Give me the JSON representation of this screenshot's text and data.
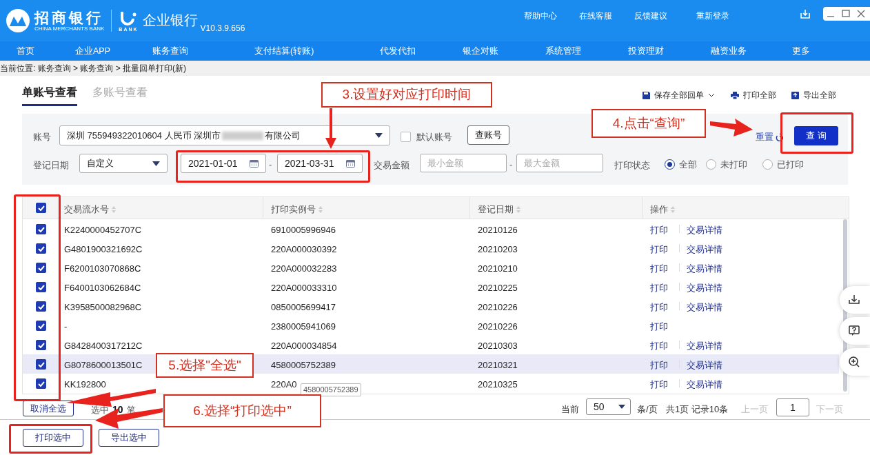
{
  "header": {
    "bank_name": "招商银行",
    "bank_name_en": "CHINA MERCHANTS BANK",
    "sub_brand": "BANK",
    "product": "企业银行",
    "version": "V10.3.9.656",
    "links": [
      "帮助中心",
      "在线客服",
      "反馈建议",
      "重新登录"
    ]
  },
  "nav": [
    "首页",
    "企业APP",
    "账务查询",
    "支付结算(转账)",
    "代发代扣",
    "银企对账",
    "系统管理",
    "投资理财",
    "融资业务",
    "更多"
  ],
  "breadcrumb": "当前位置: 账务查询 > 账务查询 > 批量回单打印(新)",
  "tabs": [
    {
      "label": "单账号查看",
      "selected": true
    },
    {
      "label": "多账号查看",
      "selected": false
    }
  ],
  "toolbar": [
    "保存全部回单",
    "打印全部",
    "导出全部"
  ],
  "filters": {
    "account_label": "账号",
    "account_value_start": "深圳 755949322010604 人民币 深圳市",
    "account_value_end": "有限公司",
    "default_account": {
      "label": "默认账号",
      "checked": false
    },
    "lookup_button": "查账号",
    "date_label": "登记日期",
    "date_mode": "自定义",
    "date_from": "2021-01-01",
    "date_separator": "-",
    "date_to": "2021-03-31",
    "amount_label": "交易金额",
    "amount_min_placeholder": "最小金额",
    "amount_separator": "-",
    "amount_max_placeholder": "最大金额",
    "print_status_label": "打印状态",
    "print_status": [
      {
        "label": "全部",
        "selected": true
      },
      {
        "label": "未打印",
        "selected": false
      },
      {
        "label": "已打印",
        "selected": false
      }
    ],
    "reset": "重置",
    "query": "查 询"
  },
  "table": {
    "all_checked": true,
    "columns": [
      "交易流水号",
      "打印实例号",
      "登记日期",
      "操作"
    ],
    "rows": [
      {
        "serial": "K2240000452707C",
        "instance": "6910005996946",
        "date": "20210126",
        "actions": [
          "打印",
          "交易详情"
        ],
        "checked": true,
        "selected": false
      },
      {
        "serial": "G4801900321692C",
        "instance": "220A000030392",
        "date": "20210203",
        "actions": [
          "打印",
          "交易详情"
        ],
        "checked": true,
        "selected": false
      },
      {
        "serial": "F6200103070868C",
        "instance": "220A000032283",
        "date": "20210210",
        "actions": [
          "打印",
          "交易详情"
        ],
        "checked": true,
        "selected": false
      },
      {
        "serial": "F6400103062684C",
        "instance": "220A000033310",
        "date": "20210225",
        "actions": [
          "打印",
          "交易详情"
        ],
        "checked": true,
        "selected": false
      },
      {
        "serial": "K3958500082968C",
        "instance": "0850005699417",
        "date": "20210226",
        "actions": [
          "打印",
          "交易详情"
        ],
        "checked": true,
        "selected": false
      },
      {
        "serial": "-",
        "instance": "2380005941069",
        "date": "20210226",
        "actions": [
          "打印"
        ],
        "checked": true,
        "selected": false
      },
      {
        "serial": "G8428400317212C",
        "instance": "220A000034854",
        "date": "20210303",
        "actions": [
          "打印",
          "交易详情"
        ],
        "checked": true,
        "selected": false
      },
      {
        "serial": "G8078600013501C",
        "instance": "4580005752389",
        "date": "20210321",
        "actions": [
          "打印",
          "交易详情"
        ],
        "checked": true,
        "selected": true
      },
      {
        "serial": "KK192800",
        "instance": "220A0",
        "date": "20210325",
        "actions": [
          "打印",
          "交易详情"
        ],
        "checked": true,
        "selected": false
      }
    ],
    "tooltip": "4580005752389"
  },
  "footer": {
    "deselect_all": "取消全选",
    "selected_prefix": "选中",
    "selected_count": "10",
    "selected_unit": "笔",
    "page_size_label": "当前",
    "page_size": "50",
    "per_page": "条/页",
    "summary": "共1页 记录10条",
    "prev": "上一页",
    "page": "1",
    "next": "下一页"
  },
  "actions": [
    "打印选中",
    "导出选中"
  ],
  "annotations": [
    "3.设置好对应打印时间",
    "4.点击“查询”",
    "5.选择\"全选\"",
    "6.选择“打印选中”"
  ]
}
